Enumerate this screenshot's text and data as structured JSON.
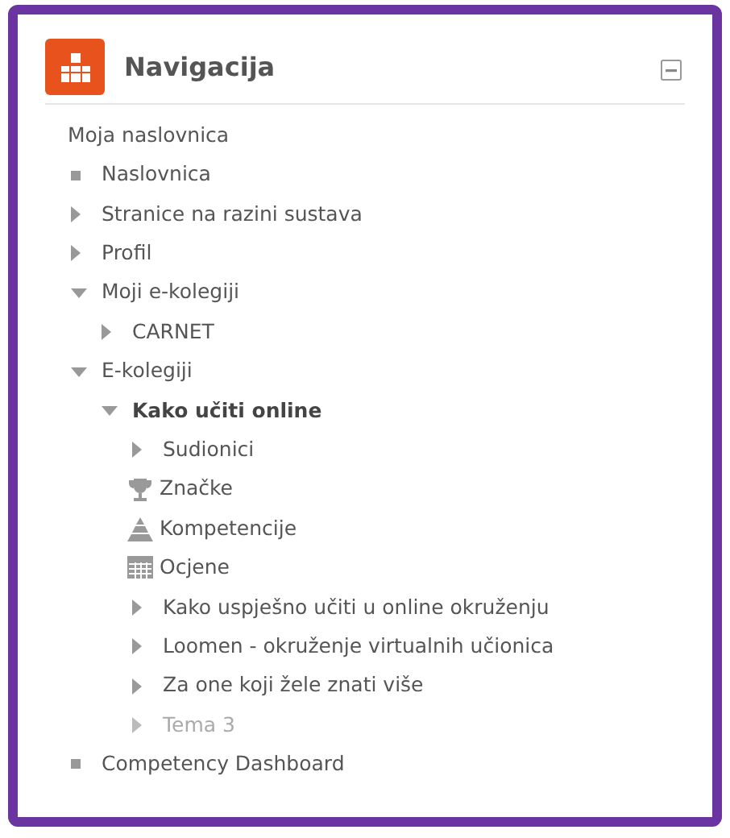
{
  "block": {
    "title": "Navigacija"
  },
  "tree": {
    "label": "Moja naslovnica",
    "children": [
      {
        "label": "Naslovnica",
        "kind": "leaf"
      },
      {
        "label": "Stranice na razini sustava",
        "kind": "branch",
        "expanded": false
      },
      {
        "label": "Profil",
        "kind": "branch",
        "expanded": false
      },
      {
        "label": "Moji e-kolegiji",
        "kind": "branch",
        "expanded": true,
        "children": [
          {
            "label": "CARNET",
            "kind": "branch",
            "expanded": false
          }
        ]
      },
      {
        "label": "E-kolegiji",
        "kind": "branch",
        "expanded": true,
        "children": [
          {
            "label": "Kako učiti online",
            "kind": "branch",
            "expanded": true,
            "current": true,
            "children": [
              {
                "label": "Sudionici",
                "kind": "branch",
                "expanded": false,
                "dimmed": false
              },
              {
                "label": "Značke",
                "kind": "trophy",
                "dimmed": false
              },
              {
                "label": "Kompetencije",
                "kind": "pyramid",
                "dimmed": false
              },
              {
                "label": "Ocjene",
                "kind": "table",
                "dimmed": false
              },
              {
                "label": "Kako uspješno učiti u online okruženju",
                "kind": "branch",
                "expanded": false,
                "dimmed": false
              },
              {
                "label": "Loomen - okruženje virtualnih učionica",
                "kind": "branch",
                "expanded": false,
                "dimmed": false
              },
              {
                "label": "Za one koji žele znati više",
                "kind": "branch",
                "expanded": false,
                "dimmed": false
              },
              {
                "label": "Tema 3",
                "kind": "branch",
                "expanded": false,
                "dimmed": true
              }
            ]
          }
        ]
      },
      {
        "label": "Competency Dashboard",
        "kind": "leaf"
      }
    ]
  }
}
